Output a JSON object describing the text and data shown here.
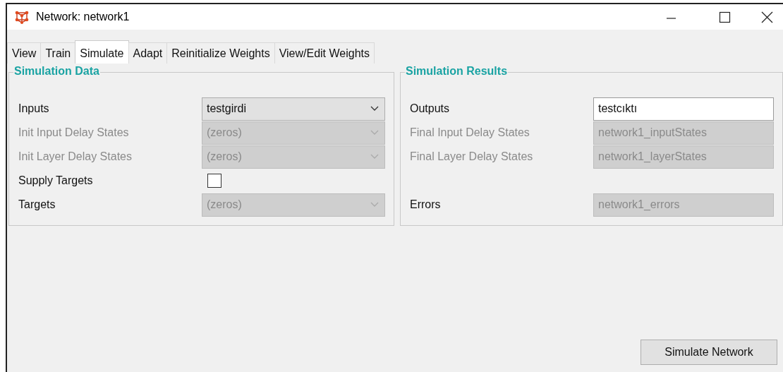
{
  "window": {
    "title": "Network: network1"
  },
  "tabs": [
    {
      "label": "View",
      "selected": false
    },
    {
      "label": "Train",
      "selected": false
    },
    {
      "label": "Simulate",
      "selected": true
    },
    {
      "label": "Adapt",
      "selected": false
    },
    {
      "label": "Reinitialize Weights",
      "selected": false
    },
    {
      "label": "View/Edit Weights",
      "selected": false
    }
  ],
  "simulation_data": {
    "title": "Simulation Data",
    "rows": [
      {
        "kind": "dropdown",
        "label": "Inputs",
        "label_disabled": false,
        "value": "testgirdi",
        "disabled": false
      },
      {
        "kind": "dropdown",
        "label": "Init Input Delay States",
        "label_disabled": true,
        "value": "(zeros)",
        "disabled": true
      },
      {
        "kind": "dropdown",
        "label": "Init Layer Delay States",
        "label_disabled": true,
        "value": "(zeros)",
        "disabled": true
      },
      {
        "kind": "checkbox",
        "label": "Supply Targets",
        "label_disabled": false,
        "checked": false,
        "disabled": false
      },
      {
        "kind": "dropdown",
        "label": "Targets",
        "label_disabled": false,
        "value": "(zeros)",
        "disabled": true
      }
    ]
  },
  "simulation_results": {
    "title": "Simulation Results",
    "rows": [
      {
        "kind": "text",
        "label": "Outputs",
        "label_disabled": false,
        "value": "testcıktı",
        "disabled": false
      },
      {
        "kind": "text",
        "label": "Final Input Delay States",
        "label_disabled": true,
        "value": "network1_inputStates",
        "disabled": true
      },
      {
        "kind": "text",
        "label": "Final Layer Delay States",
        "label_disabled": true,
        "value": "network1_layerStates",
        "disabled": true
      },
      {
        "kind": "text",
        "label": "Errors",
        "label_disabled": false,
        "value": "network1_errors",
        "disabled": true
      }
    ]
  },
  "buttons": [
    "Simulate Network"
  ]
}
